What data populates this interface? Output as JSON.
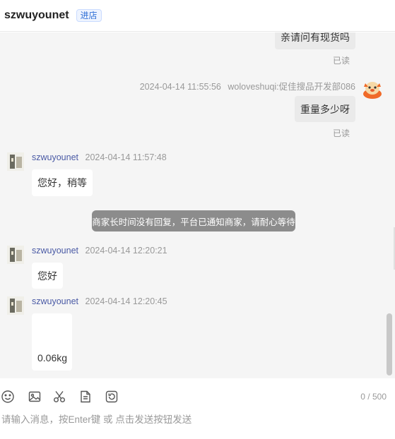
{
  "header": {
    "title": "szwuyounet",
    "store_badge": "进店"
  },
  "messages": [
    {
      "text": "亲请问有现货吗",
      "read": "已读"
    },
    {
      "time": "2024-04-14 11:55:56",
      "sender": "woloveshuqi:促佳搜品开发部086",
      "text": "重量多少呀",
      "read": "已读"
    },
    {
      "sender": "szwuyounet",
      "time": "2024-04-14 11:57:48",
      "text": "您好，稍等"
    },
    {
      "system": "商家长时间没有回复，平台已通知商家，请耐心等待"
    },
    {
      "sender": "szwuyounet",
      "time": "2024-04-14 12:20:21",
      "text": "您好"
    },
    {
      "sender": "szwuyounet",
      "time": "2024-04-14 12:20:45",
      "text": "0.06kg"
    }
  ],
  "toolbar": {
    "icons": [
      "emoji-icon",
      "image-icon",
      "scissors-icon",
      "document-icon",
      "history-icon"
    ],
    "counter": "0 / 500"
  },
  "input": {
    "placeholder": "请输入消息，按Enter键 或 点击发送按钮发送",
    "value": ""
  }
}
